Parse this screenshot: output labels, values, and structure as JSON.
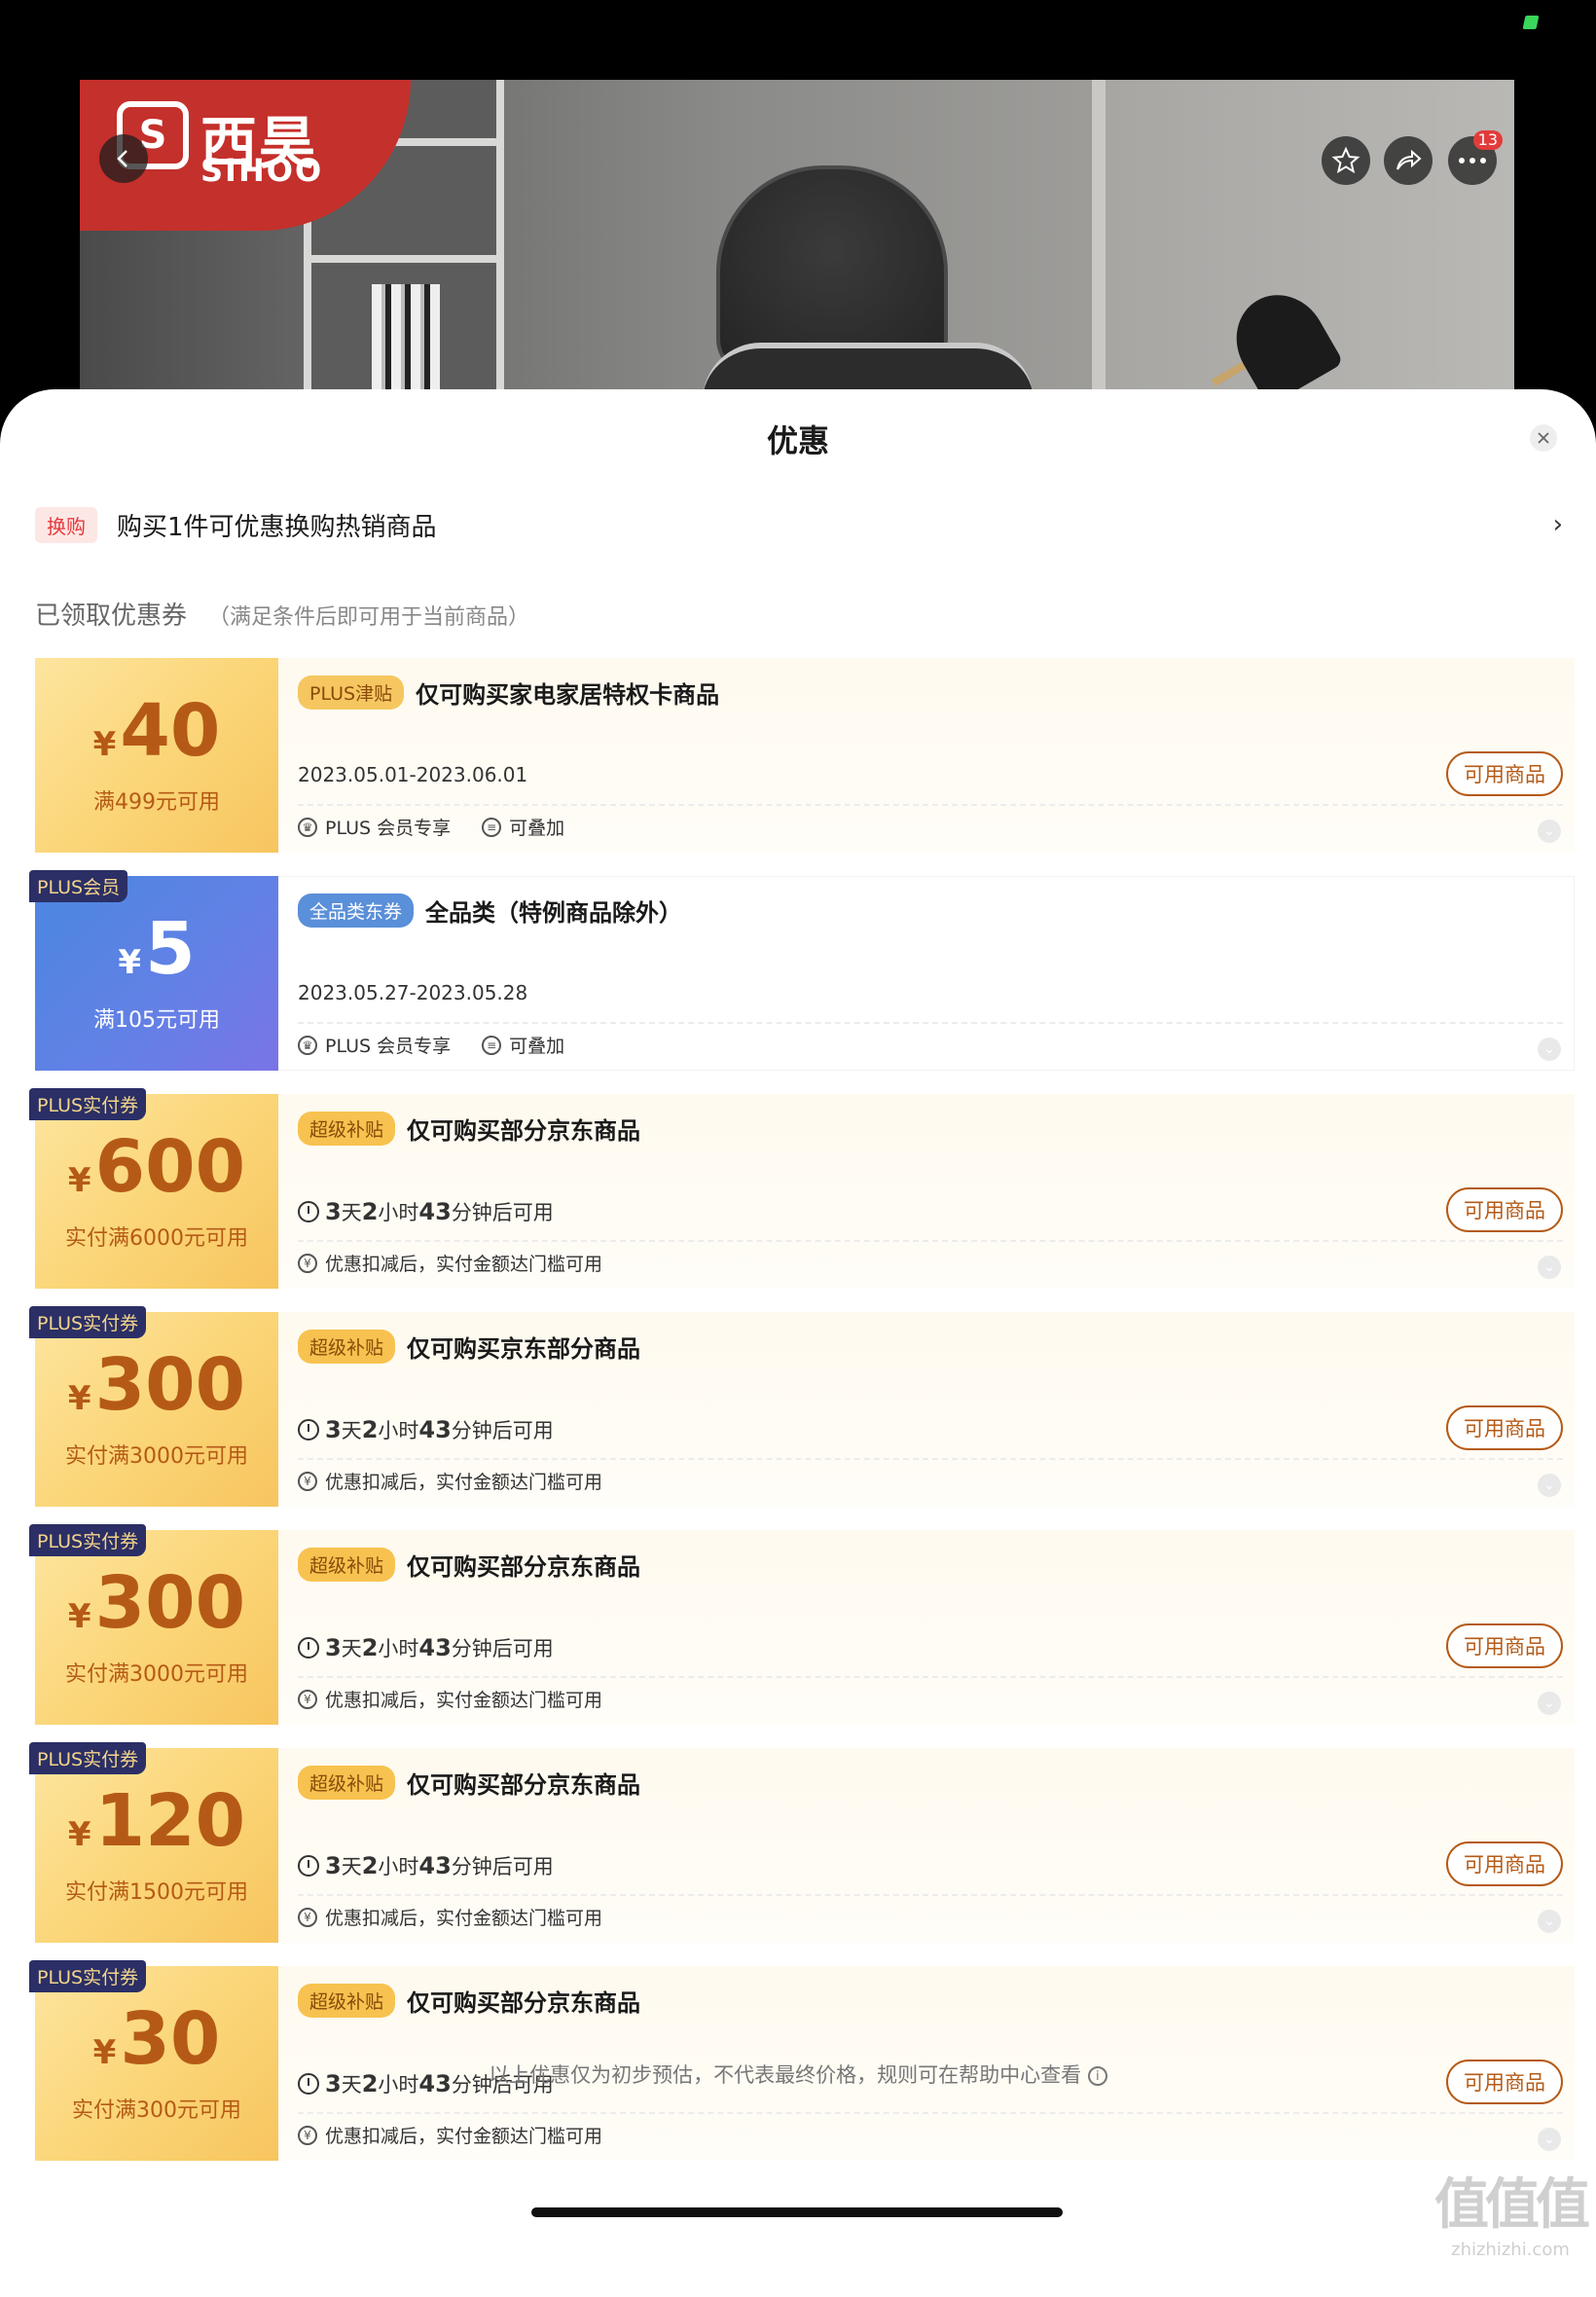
{
  "top": {
    "brand_cn": "西昊",
    "brand_en": "SIHOO",
    "notif_count": "13"
  },
  "sheet": {
    "title": "优惠",
    "swap_tag": "换购",
    "swap_text": "购买1件可优惠换购热销商品",
    "swap_arrow": "›",
    "section_title": "已领取优惠券",
    "section_sub": "（满足条件后即可用于当前商品）",
    "disclaimer": "以上优惠仅为初步预估，不代表最终价格，规则可在帮助中心查看",
    "watermark_1": "值值值",
    "watermark_2": "zhizhizhi.com"
  },
  "coupons": [
    {
      "corner": "",
      "amount": "40",
      "condition": "满499元可用",
      "tag": "PLUS津贴",
      "title": "仅可购买家电家居特权卡商品",
      "date": "2023.05.01-2023.06.01",
      "btn": "可用商品",
      "foot1": "PLUS 会员专享",
      "foot2": "可叠加"
    },
    {
      "corner": "PLUS会员",
      "amount": "5",
      "condition": "满105元可用",
      "tag": "全品类东券",
      "title": "全品类（特例商品除外）",
      "date": "2023.05.27-2023.05.28",
      "foot1": "PLUS 会员专享",
      "foot2": "可叠加"
    },
    {
      "corner": "PLUS实付券",
      "amount": "600",
      "condition": "实付满6000元可用",
      "tag": "超级补贴",
      "title": "仅可购买部分京东商品",
      "t1": "3",
      "t1u": "天",
      "t2": "2",
      "t2u": "小时",
      "t3": "43",
      "t3u": "分钟后可用",
      "btn": "可用商品",
      "foot1": "优惠扣减后，实付金额达门槛可用"
    },
    {
      "corner": "PLUS实付券",
      "amount": "300",
      "condition": "实付满3000元可用",
      "tag": "超级补贴",
      "title": "仅可购买京东部分商品",
      "t1": "3",
      "t1u": "天",
      "t2": "2",
      "t2u": "小时",
      "t3": "43",
      "t3u": "分钟后可用",
      "btn": "可用商品",
      "foot1": "优惠扣减后，实付金额达门槛可用"
    },
    {
      "corner": "PLUS实付券",
      "amount": "300",
      "condition": "实付满3000元可用",
      "tag": "超级补贴",
      "title": "仅可购买部分京东商品",
      "t1": "3",
      "t1u": "天",
      "t2": "2",
      "t2u": "小时",
      "t3": "43",
      "t3u": "分钟后可用",
      "btn": "可用商品",
      "foot1": "优惠扣减后，实付金额达门槛可用"
    },
    {
      "corner": "PLUS实付券",
      "amount": "120",
      "condition": "实付满1500元可用",
      "tag": "超级补贴",
      "title": "仅可购买部分京东商品",
      "t1": "3",
      "t1u": "天",
      "t2": "2",
      "t2u": "小时",
      "t3": "43",
      "t3u": "分钟后可用",
      "btn": "可用商品",
      "foot1": "优惠扣减后，实付金额达门槛可用"
    },
    {
      "corner": "PLUS实付券",
      "amount": "30",
      "condition": "实付满300元可用",
      "tag": "超级补贴",
      "title": "仅可购买部分京东商品",
      "t1": "3",
      "t1u": "天",
      "t2": "2",
      "t2u": "小时",
      "t3": "43",
      "t3u": "分钟后可用",
      "btn": "可用商品",
      "foot1": "优惠扣减后，实付金额达门槛可用"
    }
  ]
}
